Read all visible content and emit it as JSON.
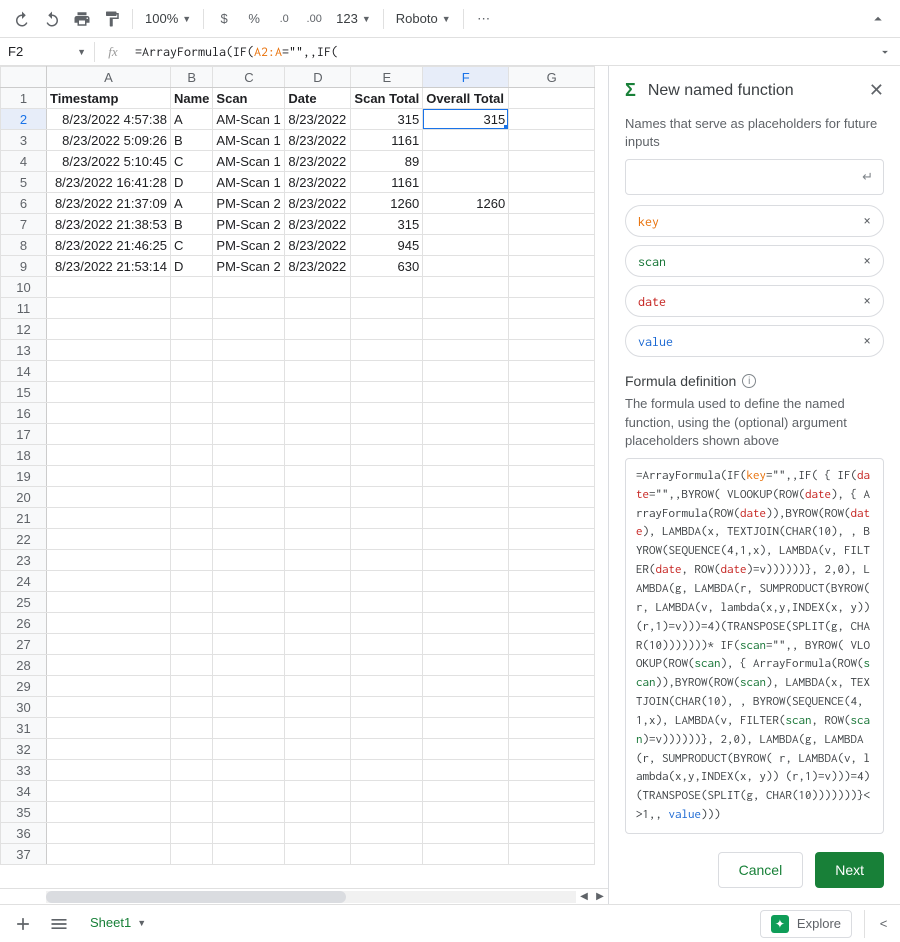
{
  "toolbar": {
    "zoom": "100%",
    "font": "Roboto",
    "decimal_formats": {
      "currency": "$",
      "percent": "%",
      "dec_less": ".0",
      "dec_more": ".00",
      "more": "123"
    }
  },
  "namebox": {
    "cell": "F2"
  },
  "formula": {
    "prefix": "=ArrayFormula(IF(",
    "ref": "A2:A",
    "suffix": "=\"\",,IF("
  },
  "columns": [
    "A",
    "B",
    "C",
    "D",
    "E",
    "F",
    "G"
  ],
  "headers": {
    "A": "Timestamp",
    "B": "Name",
    "C": "Scan",
    "D": "Date",
    "E": "Scan Total",
    "F": "Overall Total"
  },
  "rows": [
    {
      "n": 1,
      "header": true
    },
    {
      "n": 2,
      "A": "8/23/2022 4:57:38",
      "B": "A",
      "C": "AM-Scan 1",
      "D": "8/23/2022",
      "E": "315",
      "F": "315"
    },
    {
      "n": 3,
      "A": "8/23/2022 5:09:26",
      "B": "B",
      "C": "AM-Scan 1",
      "D": "8/23/2022",
      "E": "1161",
      "F": ""
    },
    {
      "n": 4,
      "A": "8/23/2022 5:10:45",
      "B": "C",
      "C": "AM-Scan 1",
      "D": "8/23/2022",
      "E": "89",
      "F": ""
    },
    {
      "n": 5,
      "A": "8/23/2022 16:41:28",
      "B": "D",
      "C": "AM-Scan 1",
      "D": "8/23/2022",
      "E": "1161",
      "F": ""
    },
    {
      "n": 6,
      "A": "8/23/2022 21:37:09",
      "B": "A",
      "C": "PM-Scan 2",
      "D": "8/23/2022",
      "E": "1260",
      "F": "1260"
    },
    {
      "n": 7,
      "A": "8/23/2022 21:38:53",
      "B": "B",
      "C": "PM-Scan 2",
      "D": "8/23/2022",
      "E": "315",
      "F": ""
    },
    {
      "n": 8,
      "A": "8/23/2022 21:46:25",
      "B": "C",
      "C": "PM-Scan 2",
      "D": "8/23/2022",
      "E": "945",
      "F": ""
    },
    {
      "n": 9,
      "A": "8/23/2022 21:53:14",
      "B": "D",
      "C": "PM-Scan 2",
      "D": "8/23/2022",
      "E": "630",
      "F": ""
    }
  ],
  "active_cell": {
    "row": 2,
    "col": "F"
  },
  "side_panel": {
    "title": "New named function",
    "placeholder_desc": "Names that serve as placeholders for future inputs",
    "enter_icon": "↵",
    "args": [
      {
        "name": "key",
        "cls": "chip-key"
      },
      {
        "name": "scan",
        "cls": "chip-scan"
      },
      {
        "name": "date",
        "cls": "chip-date"
      },
      {
        "name": "value",
        "cls": "chip-value"
      }
    ],
    "formula_def_title": "Formula definition",
    "formula_def_desc": "The formula used to define the named function, using the (optional) argument placeholders shown above",
    "tokens": [
      {
        "t": "=ArrayFormula(IF("
      },
      {
        "t": "key",
        "c": "fd-key"
      },
      {
        "t": "=\"\",,IF( { IF("
      },
      {
        "t": "date",
        "c": "fd-date"
      },
      {
        "t": "=\"\",,BYROW( VLOOKUP(ROW("
      },
      {
        "t": "date",
        "c": "fd-date"
      },
      {
        "t": "), { ArrayFormula(ROW("
      },
      {
        "t": "date",
        "c": "fd-date"
      },
      {
        "t": ")),BYROW(ROW("
      },
      {
        "t": "date",
        "c": "fd-date"
      },
      {
        "t": "), LAMBDA(x, TEXTJOIN(CHAR(10), , BYROW(SEQUENCE(4,1,x), LAMBDA(v, FILTER("
      },
      {
        "t": "date",
        "c": "fd-date"
      },
      {
        "t": ", ROW("
      },
      {
        "t": "date",
        "c": "fd-date"
      },
      {
        "t": ")=v))))))}, 2,0), LAMBDA(g, LAMBDA(r, SUMPRODUCT(BYROW( r, LAMBDA(v, lambda(x,y,INDEX(x, y)) (r,1)=v)))=4)(TRANSPOSE(SPLIT(g, CHAR(10)))))))* IF("
      },
      {
        "t": "scan",
        "c": "fd-scan"
      },
      {
        "t": "=\"\",, BYROW( VLOOKUP(ROW("
      },
      {
        "t": "scan",
        "c": "fd-scan"
      },
      {
        "t": "), { ArrayFormula(ROW("
      },
      {
        "t": "scan",
        "c": "fd-scan"
      },
      {
        "t": ")),BYROW(ROW("
      },
      {
        "t": "scan",
        "c": "fd-scan"
      },
      {
        "t": "), LAMBDA(x, TEXTJOIN(CHAR(10), , BYROW(SEQUENCE(4,1,x), LAMBDA(v, FILTER("
      },
      {
        "t": "scan",
        "c": "fd-scan"
      },
      {
        "t": ", ROW("
      },
      {
        "t": "scan",
        "c": "fd-scan"
      },
      {
        "t": ")=v))))))}, 2,0), LAMBDA(g, LAMBDA(r, SUMPRODUCT(BYROW( r, LAMBDA(v, lambda(x,y,INDEX(x, y)) (r,1)=v)))=4)(TRANSPOSE(SPLIT(g, CHAR(10)))))))}<>1,, "
      },
      {
        "t": "value",
        "c": "fd-value"
      },
      {
        "t": ")))"
      }
    ],
    "cancel": "Cancel",
    "next": "Next"
  },
  "bottom": {
    "sheet_name": "Sheet1",
    "explore": "Explore"
  }
}
